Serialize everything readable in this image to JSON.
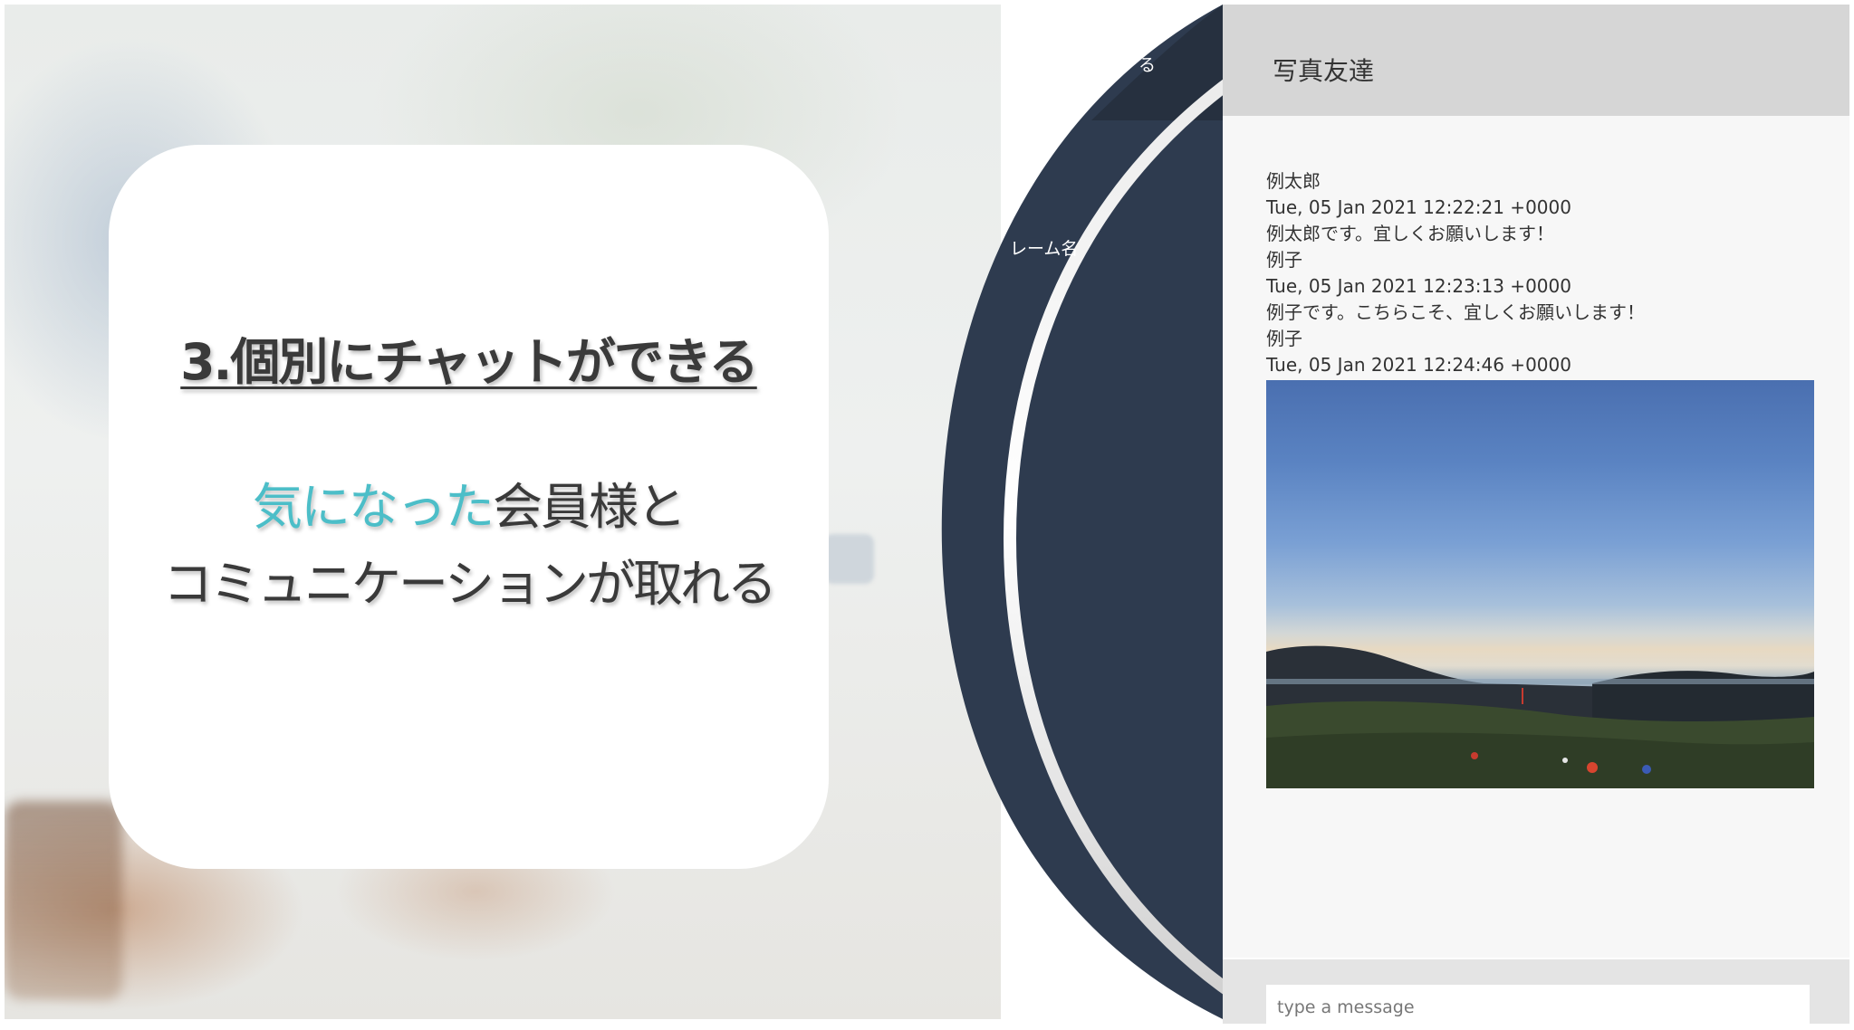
{
  "slide": {
    "title": "3.個別にチャットができる",
    "line1_accent": "気になった",
    "line1_rest": "会員様と",
    "line2": "コミュニケーションが取れる"
  },
  "sidebar": {
    "top_item_partial": "る",
    "room_name_partial": "レーム名"
  },
  "chat": {
    "room_title": "写真友達",
    "messages": [
      {
        "author": "例太郎",
        "time": "Tue, 05 Jan 2021 12:22:21 +0000",
        "text": "例太郎です。宜しくお願いします！"
      },
      {
        "author": "例子",
        "time": "Tue, 05 Jan 2021 12:23:13 +0000",
        "text": "例子です。こちらこそ、宜しくお願いします！"
      },
      {
        "author": "例子",
        "time": "Tue, 05 Jan 2021 12:24:46 +0000",
        "image": "landscape-photo"
      }
    ],
    "input_placeholder": "type a message"
  },
  "colors": {
    "accent_teal": "#4cbec8",
    "sidebar_dark": "#2e3b4f",
    "header_gray": "#d6d6d6"
  }
}
